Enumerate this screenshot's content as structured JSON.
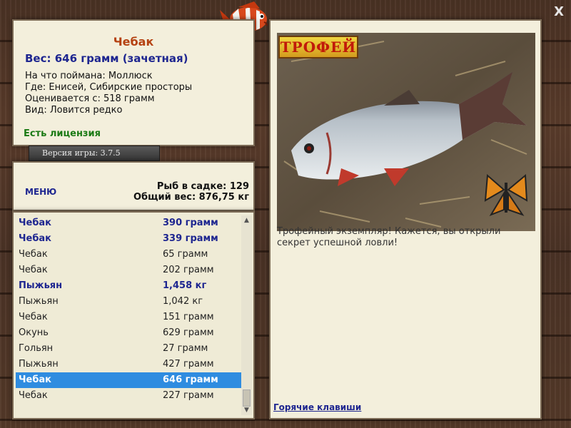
{
  "info": {
    "title": "Чебак",
    "weight_line": "Вес: 646 грамм (зачетная)",
    "lines": [
      "На что поймана: Моллюск",
      "Где: Енисей, Сибирские просторы",
      "Оценивается с: 518 грамм",
      "Вид: Ловится редко"
    ],
    "license": "Есть лицензия"
  },
  "version_label": "Версия игры: 3.7.5",
  "catch": {
    "menu_label": "МЕНЮ",
    "fish_count": "Рыб в садке: 129",
    "total_weight": "Общий вес: 876,75 кг"
  },
  "fish_list": [
    {
      "name": "Чебак",
      "weight": "390 грамм",
      "trophy": true
    },
    {
      "name": "Чебак",
      "weight": "339 грамм",
      "trophy": true
    },
    {
      "name": "Чебак",
      "weight": "65 грамм",
      "trophy": false
    },
    {
      "name": "Чебак",
      "weight": "202 грамм",
      "trophy": false
    },
    {
      "name": "Пыжьян",
      "weight": "1,458 кг",
      "trophy": true
    },
    {
      "name": "Пыжьян",
      "weight": "1,042 кг",
      "trophy": false
    },
    {
      "name": "Чебак",
      "weight": "151 грамм",
      "trophy": false
    },
    {
      "name": "Окунь",
      "weight": "629 грамм",
      "trophy": false
    },
    {
      "name": "Гольян",
      "weight": "27 грамм",
      "trophy": false
    },
    {
      "name": "Пыжьян",
      "weight": "427 грамм",
      "trophy": false
    },
    {
      "name": "Чебак",
      "weight": "646 грамм",
      "trophy": true,
      "selected": true
    },
    {
      "name": "Чебак",
      "weight": "227 грамм",
      "trophy": false
    }
  ],
  "trophy": {
    "badge": "ТРОФЕЙ",
    "text": "Трофейный экземпляр! Кажется, вы открыли секрет успешной ловли!"
  },
  "hotkeys_label": "Горячие клавиши",
  "close_label": "X",
  "colors": {
    "title": "#b54212",
    "accent_blue": "#1e2690",
    "license_green": "#1b7a14",
    "selection": "#2f8ce0",
    "panel_bg": "#f3efdc"
  },
  "icons": [
    "logo-fish-icon",
    "butterfly-icon",
    "close-icon",
    "scroll-up-icon",
    "scroll-down-icon"
  ]
}
